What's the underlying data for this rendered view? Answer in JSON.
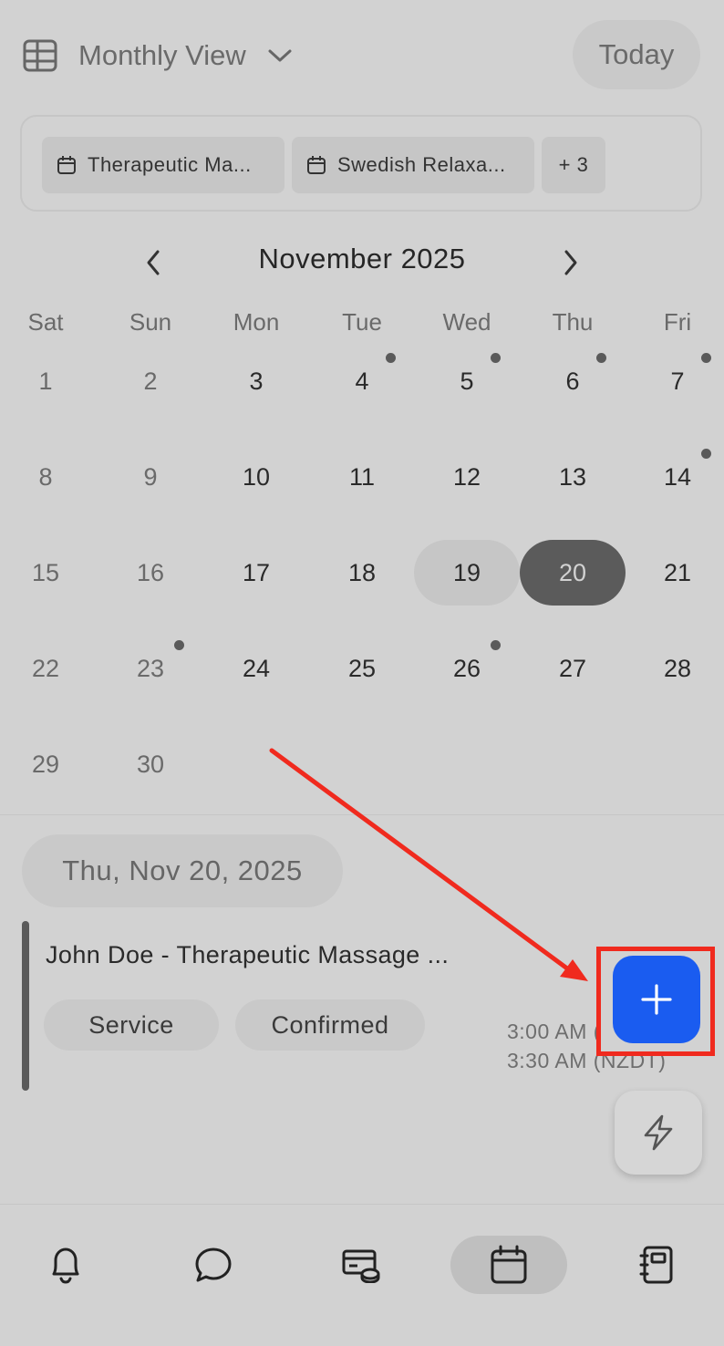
{
  "header": {
    "view_label": "Monthly View",
    "today_label": "Today",
    "icons": {
      "view": "table-grid-icon",
      "dropdown": "chevron-down-icon"
    }
  },
  "filters": {
    "chips": [
      "Therapeutic Ma...",
      "Swedish Relaxa..."
    ],
    "more_label": "+ 3"
  },
  "calendar": {
    "month_title": "November 2025",
    "weekdays": [
      "Sat",
      "Sun",
      "Mon",
      "Tue",
      "Wed",
      "Thu",
      "Fri"
    ],
    "weeks": [
      [
        "1",
        "2",
        "3",
        "4",
        "5",
        "6",
        "7"
      ],
      [
        "8",
        "9",
        "10",
        "11",
        "12",
        "13",
        "14"
      ],
      [
        "15",
        "16",
        "17",
        "18",
        "19",
        "20",
        "21"
      ],
      [
        "22",
        "23",
        "24",
        "25",
        "26",
        "27",
        "28"
      ],
      [
        "29",
        "30",
        "",
        "",
        "",
        "",
        ""
      ]
    ],
    "days_with_events": [
      "4",
      "5",
      "6",
      "7",
      "14",
      "23",
      "26"
    ],
    "highlighted_day": "19",
    "selected_day": "20"
  },
  "agenda": {
    "date_label": "Thu, Nov 20, 2025",
    "event": {
      "title": "John Doe - Therapeutic Massage ...",
      "tags": [
        "Service",
        "Confirmed"
      ],
      "start_time": "3:00 AM (",
      "end_time": "3:30 AM (NZDT)"
    }
  },
  "fabs": {
    "add_icon": "plus-icon",
    "quick_icon": "lightning-bolt-icon"
  },
  "bottom_nav": {
    "tabs": [
      "bell-icon",
      "chat-bubble-icon",
      "cards-icon",
      "calendar-icon",
      "notebook-icon"
    ],
    "active_tab": "calendar-icon"
  },
  "colors": {
    "background": "#d2d2d2",
    "accent_blue": "#1a5cf0",
    "annotation_red": "#f02a1e",
    "selected_day": "#5b5b5b"
  }
}
